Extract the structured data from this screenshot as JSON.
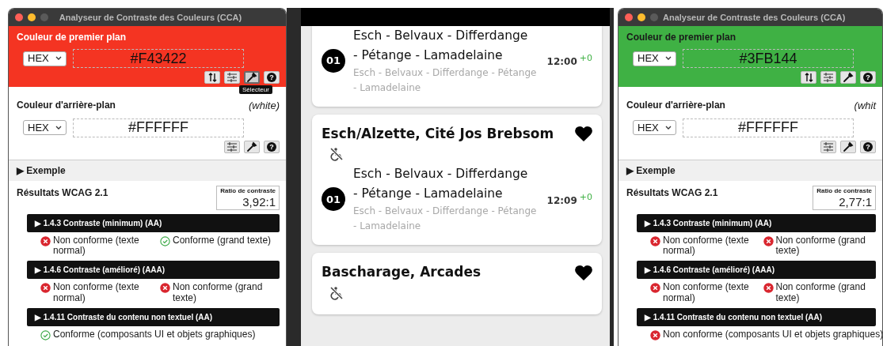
{
  "windows": [
    {
      "title": "Analyseur de Contraste des Couleurs (CCA)",
      "foreground": {
        "label": "Couleur de premier plan",
        "color": "#f43422",
        "format": "HEX",
        "value": "#F43422",
        "tools": [
          {
            "kind": "swap",
            "hovered": false
          },
          {
            "kind": "adjust",
            "hovered": false
          },
          {
            "kind": "picker",
            "hovered": true,
            "tooltip": "Sélecteur"
          },
          {
            "kind": "help",
            "hovered": false,
            "glyph": "?"
          }
        ]
      },
      "background": {
        "label": "Couleur d'arrière-plan",
        "name": "(white)",
        "format": "HEX",
        "value": "#FFFFFF",
        "tools": [
          {
            "kind": "adjust",
            "hovered": false
          },
          {
            "kind": "picker",
            "hovered": false
          },
          {
            "kind": "help",
            "hovered": false,
            "glyph": "?"
          }
        ]
      },
      "example": {
        "toggle": "▶",
        "label": "Exemple"
      },
      "results": {
        "title": "Résultats WCAG 2.1",
        "ratio_label": "Ratio de contraste",
        "ratio": "3,92:1",
        "criteria": [
          {
            "toggle": "▶",
            "title": "1.4.3 Contraste (minimum) (AA)",
            "outcomes": [
              {
                "passed": false,
                "text": "Non conforme (texte normal)"
              },
              {
                "passed": true,
                "text": "Conforme (grand texte)"
              }
            ]
          },
          {
            "toggle": "▶",
            "title": "1.4.6 Contraste (amélioré) (AAA)",
            "outcomes": [
              {
                "passed": false,
                "text": "Non conforme (texte normal)"
              },
              {
                "passed": false,
                "text": "Non conforme (grand texte)"
              }
            ]
          },
          {
            "toggle": "▶",
            "title": "1.4.11 Contraste du contenu non textuel (AA)",
            "outcomes": [
              {
                "passed": true,
                "text": "Conforme (composants UI et objets graphiques)"
              }
            ]
          }
        ]
      }
    },
    {
      "title": "Analyseur de Contraste des Couleurs (CCA)",
      "foreground": {
        "label": "Couleur de premier plan",
        "color": "#3fb144",
        "format": "HEX",
        "value": "#3FB144",
        "tools": [
          {
            "kind": "swap",
            "hovered": false
          },
          {
            "kind": "adjust",
            "hovered": false
          },
          {
            "kind": "picker",
            "hovered": false
          },
          {
            "kind": "help",
            "hovered": false,
            "glyph": "?"
          }
        ]
      },
      "background": {
        "label": "Couleur d'arrière-plan",
        "name": "(whit",
        "format": "HEX",
        "value": "#FFFFFF",
        "tools": [
          {
            "kind": "adjust",
            "hovered": false
          },
          {
            "kind": "picker",
            "hovered": false
          },
          {
            "kind": "help",
            "hovered": false,
            "glyph": "?"
          }
        ]
      },
      "example": {
        "toggle": "▶",
        "label": "Exemple"
      },
      "results": {
        "title": "Résultats WCAG 2.1",
        "ratio_label": "Ratio de contraste",
        "ratio": "2,77:1",
        "criteria": [
          {
            "toggle": "▶",
            "title": "1.4.3 Contraste (minimum) (AA)",
            "outcomes": [
              {
                "passed": false,
                "text": "Non conforme (texte normal)"
              },
              {
                "passed": false,
                "text": "Non conforme (grand texte)"
              }
            ]
          },
          {
            "toggle": "▶",
            "title": "1.4.6 Contraste (amélioré) (AAA)",
            "outcomes": [
              {
                "passed": false,
                "text": "Non conforme (texte normal)"
              },
              {
                "passed": false,
                "text": "Non conforme (grand texte)"
              }
            ]
          },
          {
            "toggle": "▶",
            "title": "1.4.11 Contraste du contenu non textuel (AA)",
            "outcomes": [
              {
                "passed": false,
                "text": "Non conforme (composants UI et objets graphiques)"
              }
            ]
          }
        ]
      }
    }
  ],
  "phone": {
    "cards": [
      {
        "departures": [
          {
            "line": "01",
            "title": "Esch - Belvaux - Differdange - Pétange - Lamadelaine",
            "via": "Esch - Belvaux - Differdange - Pétange - Lamadelaine",
            "time": "12:00",
            "delay": "+0"
          }
        ]
      },
      {
        "stop": "Esch/Alzette, Cité Jos Brebsom",
        "favorite": true,
        "accessible": false,
        "departures": [
          {
            "line": "01",
            "title": "Esch - Belvaux - Differdange - Pétange - Lamadelaine",
            "via": "Esch - Belvaux - Differdange - Pétange - Lamadelaine",
            "time": "12:09",
            "delay": "+0"
          }
        ]
      },
      {
        "stop": "Bascharage, Arcades",
        "favorite": true,
        "accessible": false
      }
    ]
  }
}
